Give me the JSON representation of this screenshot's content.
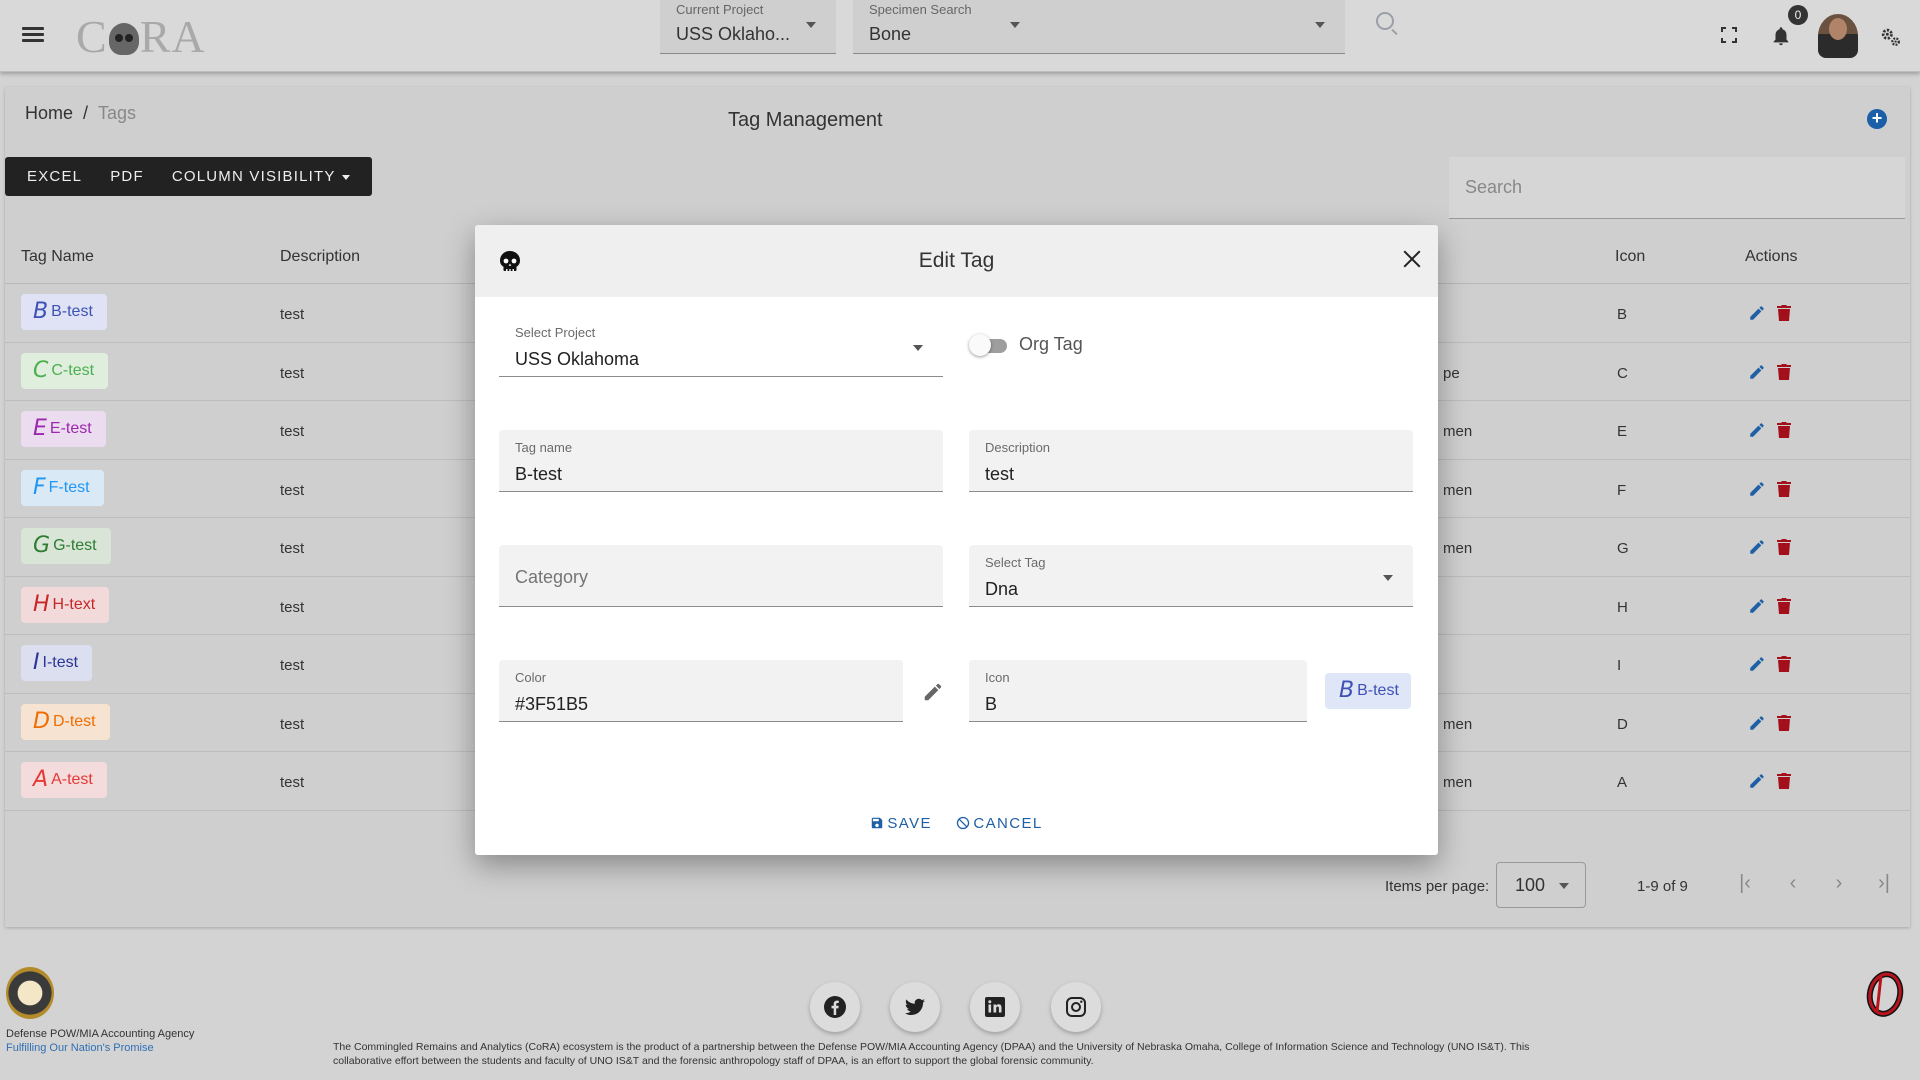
{
  "header": {
    "logo_text": "CORA",
    "current_project": {
      "label": "Current Project",
      "value": "USS Oklaho..."
    },
    "specimen_search": {
      "label": "Specimen Search",
      "value": "Bone"
    },
    "notification_count": "0"
  },
  "breadcrumb": {
    "home": "Home",
    "separator": "/",
    "current": "Tags"
  },
  "page": {
    "title": "Tag Management"
  },
  "toolbar": {
    "excel": "EXCEL",
    "pdf": "PDF",
    "column_visibility": "COLUMN VISIBILITY"
  },
  "table": {
    "search_placeholder": "Search",
    "columns": {
      "tag_name": "Tag Name",
      "description": "Description",
      "icon": "Icon",
      "actions": "Actions"
    },
    "rows": [
      {
        "glyph": "B",
        "name": "B-test",
        "description": "test",
        "category": "",
        "icon": "B",
        "color": "#3F51B5",
        "bg": "#dfe3f5"
      },
      {
        "glyph": "C",
        "name": "C-test",
        "description": "test",
        "category": "pe",
        "icon": "C",
        "color": "#4CAF50",
        "bg": "#dfeedd"
      },
      {
        "glyph": "E",
        "name": "E-test",
        "description": "test",
        "category": "men",
        "icon": "E",
        "color": "#9C27B0",
        "bg": "#ecdcef"
      },
      {
        "glyph": "F",
        "name": "F-test",
        "description": "test",
        "category": "men",
        "icon": "F",
        "color": "#2196F3",
        "bg": "#d9e9f5"
      },
      {
        "glyph": "G",
        "name": "G-test",
        "description": "test",
        "category": "men",
        "icon": "G",
        "color": "#2E7D32",
        "bg": "#d8e5d7"
      },
      {
        "glyph": "H",
        "name": "H-text",
        "description": "test",
        "category": "",
        "icon": "H",
        "color": "#C62828",
        "bg": "#f3dada"
      },
      {
        "glyph": "I",
        "name": "I-test",
        "description": "test",
        "category": "",
        "icon": "I",
        "color": "#283593",
        "bg": "#dcdfef"
      },
      {
        "glyph": "D",
        "name": "D-test",
        "description": "test",
        "category": "men",
        "icon": "D",
        "color": "#EF6C00",
        "bg": "#f7e3d2"
      },
      {
        "glyph": "A",
        "name": "A-test",
        "description": "test",
        "category": "men",
        "icon": "A",
        "color": "#E53935",
        "bg": "#f5dcdc"
      }
    ]
  },
  "pagination": {
    "items_per_page_label": "Items per page:",
    "items_per_page": "100",
    "range": "1-9 of 9"
  },
  "modal": {
    "title": "Edit Tag",
    "select_project": {
      "label": "Select Project",
      "value": "USS Oklahoma"
    },
    "org_tag_label": "Org Tag",
    "tag_name": {
      "label": "Tag name",
      "value": "B-test"
    },
    "description": {
      "label": "Description",
      "value": "test"
    },
    "category": {
      "placeholder": "Category"
    },
    "select_tag": {
      "label": "Select Tag",
      "value": "Dna"
    },
    "color": {
      "label": "Color",
      "value": "#3F51B5"
    },
    "icon": {
      "label": "Icon",
      "value": "B"
    },
    "preview_chip": {
      "glyph": "B",
      "name": "B-test"
    },
    "save_label": "SAVE",
    "cancel_label": "CANCEL"
  },
  "footer": {
    "agency": "Defense POW/MIA Accounting Agency",
    "motto": "Fulfilling Our Nation's Promise",
    "text": "The Commingled Remains and Analytics (CoRA) ecosystem is the product of a partnership between the Defense POW/MIA Accounting Agency (DPAA) and the University of Nebraska Omaha, College of Information Science and Technology (UNO IS&T). This collaborative effort between the students and faculty of UNO IS&T and the forensic anthropology staff of DPAA, is an effort to support the global forensic community."
  },
  "colors": {
    "primary": "#1f5fa6",
    "danger": "#a3101c",
    "accent": "#3F51B5"
  },
  "icons": [
    "menu-icon",
    "search-icon",
    "fullscreen-icon",
    "bell-icon",
    "settings-gears-icon",
    "add-icon",
    "edit-icon",
    "delete-icon",
    "skull-icon",
    "close-icon",
    "pencil-icon",
    "save-icon",
    "cancel-icon",
    "facebook-icon",
    "twitter-icon",
    "linkedin-icon",
    "instagram-icon"
  ]
}
